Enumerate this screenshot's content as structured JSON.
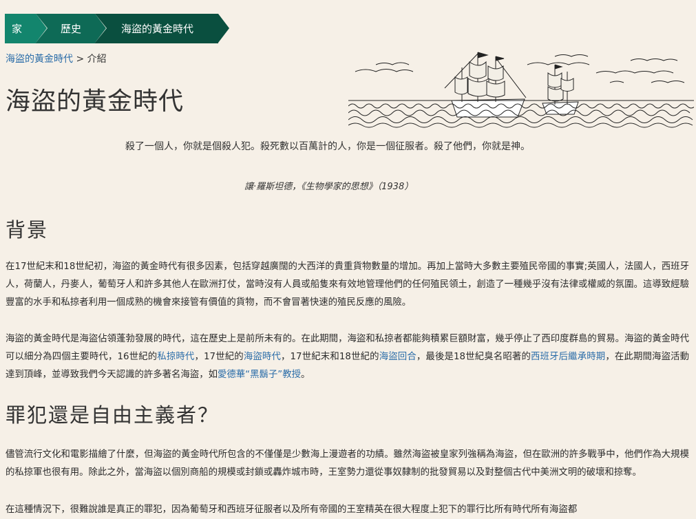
{
  "breadcrumb": {
    "home": "家",
    "history": "歷史",
    "current": "海盜的黃金時代"
  },
  "subcrumb": {
    "link": "海盜的黃金時代",
    "separator": ">",
    "current": "介紹"
  },
  "page_title": "海盜的黃金時代",
  "illustration": "sailing-ships-icon",
  "quote": {
    "text": "殺了一個人，你就是個殺人犯。殺死數以百萬計的人，你是一個征服者。殺了他們，你就是神。",
    "citation": "讓·羅斯坦德，《生物學家的思想》（1938）"
  },
  "section1": {
    "heading": "背景",
    "p1": "在17世紀末和18世紀初，海盜的黃金時代有很多因素，包括穿越廣闊的大西洋的貴重貨物數量的增加。再加上當時大多數主要殖民帝國的事實;英國人，法國人，西班牙人，荷蘭人，丹麥人，葡萄牙人和許多其他人在歐洲打仗，當時沒有人員或船隻來有效地管理他們的任何殖民領土，創造了一種幾乎沒有法律或權威的氛圍。這導致經驗豐富的水手和私掠者利用一個成熟的機會來接管有價值的貨物，而不會冒著快速的殖民反應的風險。",
    "p2": {
      "t1": "海盜的黃金時代是海盜佔領蓬勃發展的時代，這在歷史上是前所未有的。在此期間，海盜和私掠者都能夠積累巨額財富，幾乎停止了西印度群島的貿易。海盜的黃金時代可以細分為四個主要時代，16世紀的",
      "l1": "私掠時代",
      "t2": "，17世紀的",
      "l2": "海盜時代",
      "t3": "，17世紀末和18世紀的",
      "l3": "海盜回合",
      "t4": "，最後是18世紀臭名昭著的",
      "l4": "西班牙后繼承時期",
      "t5": "，在此期間海盜活動達到頂峰，並導致我們今天認識的許多著名海盜，如",
      "l5": "愛德華“黑鬍子”教授",
      "t6": "。"
    }
  },
  "section2": {
    "heading": "罪犯還是自由主義者？",
    "p1": "儘管流行文化和電影描繪了什麼，但海盜的黃金時代所包含的不僅僅是少數海上漫遊者的功績。雖然海盜被皇家列強稱為海盜，但在歐洲的許多戰爭中，他們作為大規模的私掠軍也很有用。除此之外，當海盜以個別商船的規模或封鎖或轟炸城市時，王室勢力還從事奴隸制的批發貿易以及對整個古代中美洲文明的破壞和掠奪。",
    "p2": "在這種情況下，很難說誰是真正的罪犯，因為葡萄牙和西班牙征服者以及所有帝國的王室精英在很大程度上犯下的罪行比所有時代所有海盜都"
  }
}
